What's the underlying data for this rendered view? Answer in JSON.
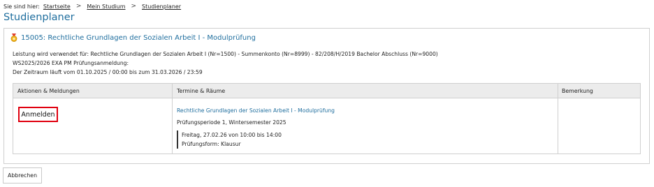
{
  "breadcrumb": {
    "prefix": "Sie sind hier:",
    "items": [
      "Startseite",
      "Mein Studium",
      "Studienplaner"
    ],
    "separator": ">"
  },
  "page": {
    "title": "Studienplaner"
  },
  "module": {
    "icon": "award-medal-icon",
    "title": "15005: Rechtliche Grundlagen der Sozialen Arbeit I - Modulprüfung",
    "info_lines": [
      "Leistung wird verwendet für: Rechtliche Grundlagen der Sozialen Arbeit I (Nr=1500) - Summenkonto (Nr=8999) - 82/208/H/2019 Bachelor Abschluss (Nr=9000)",
      "WS2025/2026 EXA PM Prüfungsanmeldung:",
      "Der Zeitraum läuft vom 01.10.2025 / 00:00 bis zum 31.03.2026 / 23:59"
    ]
  },
  "table": {
    "headers": [
      "Aktionen & Meldungen",
      "Termine & Räume",
      "Bemerkung"
    ],
    "row": {
      "action_label": "Anmelden",
      "termin_link": "Rechtliche Grundlagen der Sozialen Arbeit I - Modulprüfung",
      "period": "Prüfungsperiode 1, Wintersemester 2025",
      "date": "Freitag, 27.02.26 von 10:00 bis 14:00",
      "form": "Prüfungsform: Klausur",
      "remark": ""
    }
  },
  "footer": {
    "cancel_label": "Abbrechen"
  },
  "colors": {
    "accent": "#1f6e9e",
    "highlight_border": "#e0000f",
    "header_bg": "#ececec"
  }
}
